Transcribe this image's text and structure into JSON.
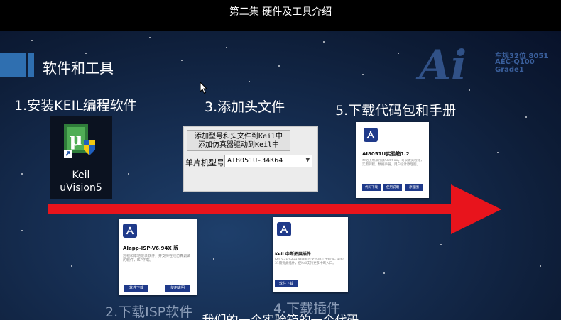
{
  "video": {
    "title": "第二集 硬件及工具介绍"
  },
  "slide": {
    "section_title": "软件和工具",
    "logo": {
      "mark": "Ai",
      "line1": "车规32位 8051",
      "line2": "AEC-Q100 Grade1"
    },
    "steps": {
      "s1": "1.安装KEIL编程软件",
      "s2": "2.下载ISP软件",
      "s3": "3.添加头文件",
      "s4": "4.下载插件",
      "s5": "5.下载代码包和手册"
    },
    "keil": {
      "line1": "Keil",
      "line2": "uVision5"
    },
    "dialog": {
      "button_line1": "添加型号和头文件到Keil中",
      "button_line2": "添加仿真器驱动到Keil中",
      "mcu_label": "单片机型号",
      "mcu_value": "AI8051U-34K64"
    },
    "card_manual": {
      "title": "AI8051U实验箱1.2",
      "desc": "本帖子用来存放AI8051U，可以做实验箱，实用例程，数据手册，用户设计原理图。",
      "btn1": "代码下载",
      "btn2": "使用说明",
      "btn3": "原理图"
    },
    "card_isp": {
      "title": "AIapp-ISP-V6.94X 版",
      "desc": "远程和本地烧录软件，并支持在线仿真调试的软件，ISP下载。",
      "btn1": "软件下载",
      "btn2": "使用说明"
    },
    "card_plugin": {
      "title": "Keil 中断拓展插件",
      "desc": "Keil C51/C251 编译器只支持32个中断号，超过31需要此插件，使Keil支持更多中断入口。",
      "btn1": "软件下载"
    }
  },
  "subtitle": "我们的一个实验箱的一个代码",
  "colors": {
    "arrow": "#e8141c",
    "accent": "#2f6fb0",
    "card_button": "#1f3a8a"
  }
}
